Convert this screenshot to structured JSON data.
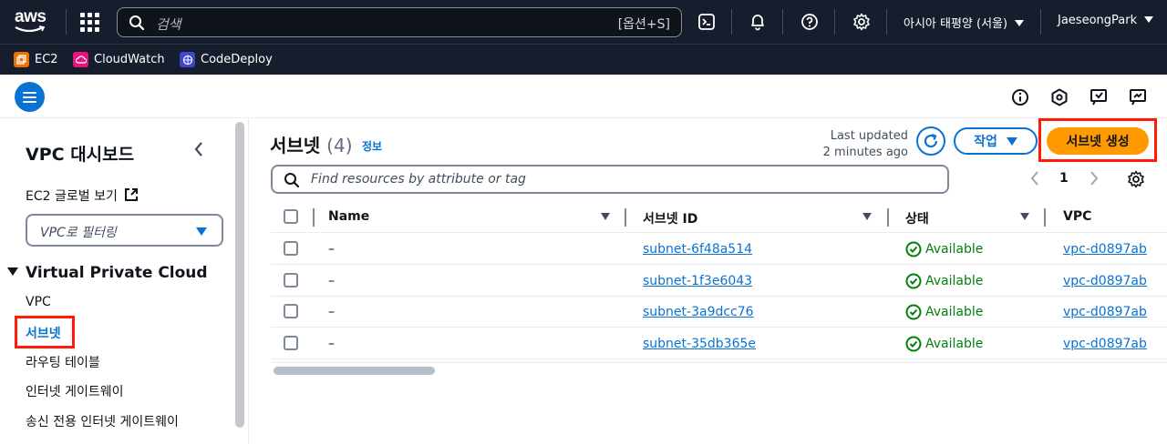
{
  "topbar": {
    "logo": "aws",
    "search_placeholder": "검색",
    "search_shortcut": "[옵션+S]",
    "region": "아시아 태평양 (서울)",
    "user": "JaeseongPark",
    "icons": [
      "apps-grid-icon",
      "search-icon",
      "cloudshell-icon",
      "bell-icon",
      "help-icon",
      "gear-icon"
    ]
  },
  "favorites": [
    {
      "label": "EC2",
      "color": "#ed7100"
    },
    {
      "label": "CloudWatch",
      "color": "#e7157b"
    },
    {
      "label": "CodeDeploy",
      "color": "#3f48cc"
    }
  ],
  "sidebar": {
    "title": "VPC 대시보드",
    "ec2_global": "EC2 글로벌 보기",
    "filter_placeholder": "VPC로 필터링",
    "section": "Virtual Private Cloud",
    "items": [
      "VPC",
      "서브넷",
      "라우팅 테이블",
      "인터넷 게이트웨이",
      "송신 전용 인터넷 게이트웨이"
    ],
    "active_item": "서브넷"
  },
  "main": {
    "title": "서브넷",
    "count": "(4)",
    "info": "정보",
    "last_updated_line1": "Last updated",
    "last_updated_line2": "2 minutes ago",
    "actions_label": "작업",
    "create_label": "서브넷 생성",
    "filter_placeholder": "Find resources by attribute or tag",
    "page": "1",
    "columns": [
      "Name",
      "서브넷 ID",
      "상태",
      "VPC"
    ],
    "rows": [
      {
        "name": "–",
        "subnet_id": "subnet-6f48a514",
        "status": "Available",
        "vpc": "vpc-d0897ab"
      },
      {
        "name": "–",
        "subnet_id": "subnet-1f3e6043",
        "status": "Available",
        "vpc": "vpc-d0897ab"
      },
      {
        "name": "–",
        "subnet_id": "subnet-3a9dcc76",
        "status": "Available",
        "vpc": "vpc-d0897ab"
      },
      {
        "name": "–",
        "subnet_id": "subnet-35db365e",
        "status": "Available",
        "vpc": "vpc-d0897ab"
      }
    ]
  },
  "colors": {
    "nav_bg": "#161e2d",
    "link_blue": "#0972d3",
    "primary_orange": "#ff9900",
    "success_green": "#037f0c",
    "highlight_red": "#ff1a0a"
  }
}
